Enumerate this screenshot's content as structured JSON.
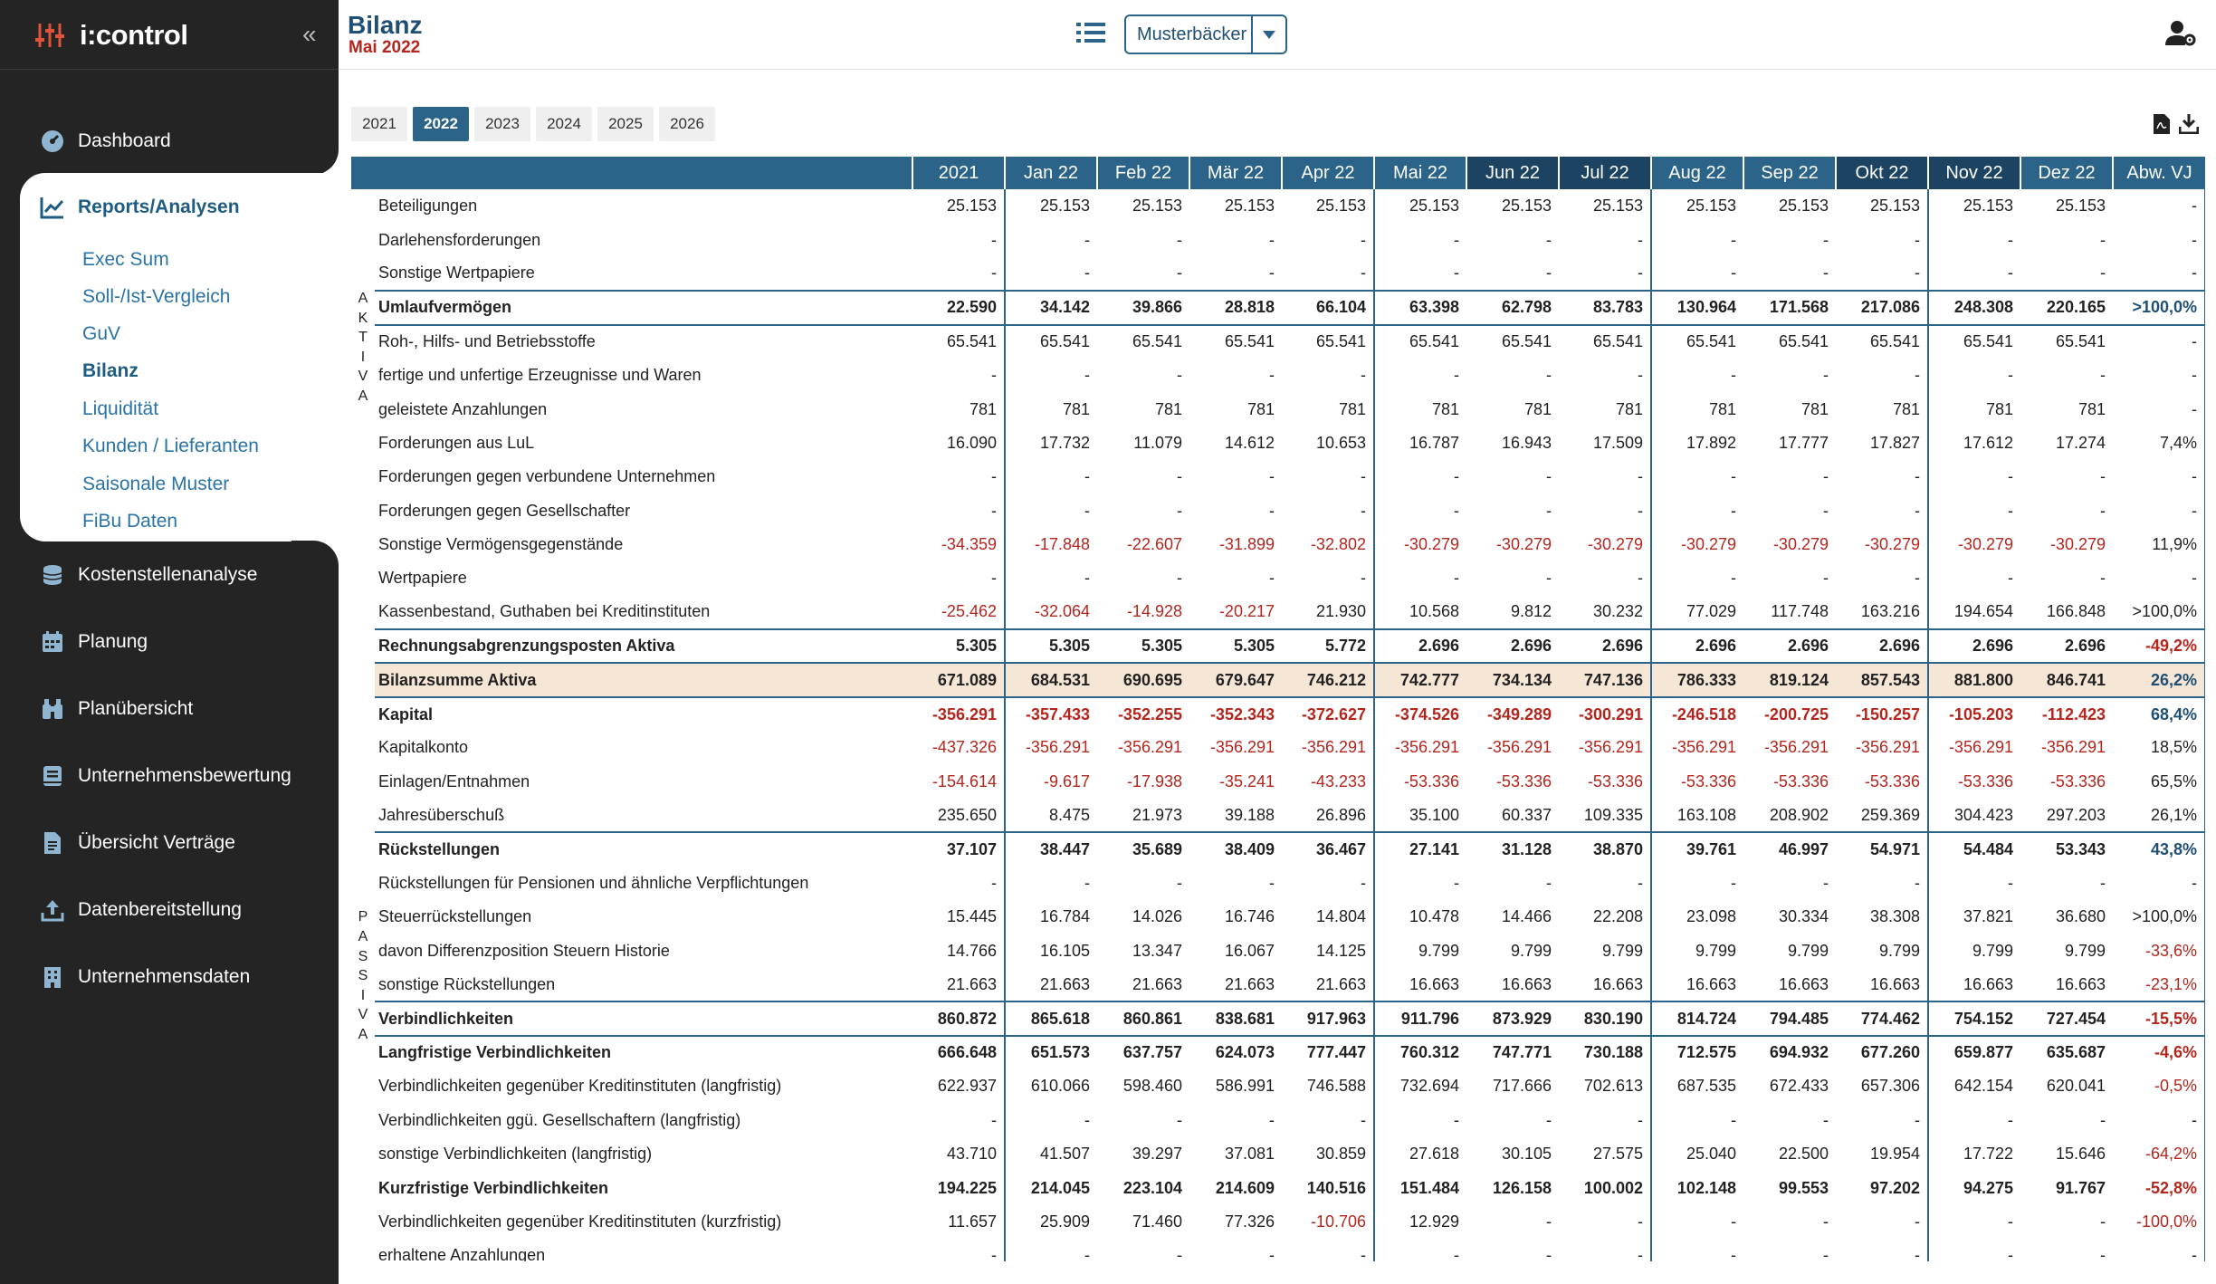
{
  "app": {
    "name": "i:control",
    "collapse_icon": "double-chevron-left-icon"
  },
  "nav": {
    "dashboard": "Dashboard",
    "reports": "Reports/Analysen",
    "sub": [
      "Exec Sum",
      "Soll-/Ist-Vergleich",
      "GuV",
      "Bilanz",
      "Liquidität",
      "Kunden / Lieferanten",
      "Saisonale Muster",
      "FiBu Daten"
    ],
    "kosten": "Kostenstellenanalyse",
    "planung": "Planung",
    "planuebersicht": "Planübersicht",
    "bewertung": "Unternehmensbewertung",
    "vertraege": "Übersicht Verträge",
    "datenbereit": "Datenbereitstellung",
    "unternehmen": "Unternehmensdaten"
  },
  "header": {
    "title": "Bilanz",
    "subtitle": "Mai 2022",
    "company": "Musterbäcker"
  },
  "years": [
    "2021",
    "2022",
    "2023",
    "2024",
    "2025",
    "2026"
  ],
  "selected_year": "2022",
  "side_labels": {
    "aktiva": "AKTIVA",
    "passiva": "PASSIVA"
  },
  "table": {
    "columns": [
      "2021",
      "Jan 22",
      "Feb 22",
      "Mär 22",
      "Apr 22",
      "Mai 22",
      "Jun 22",
      "Jul 22",
      "Aug 22",
      "Sep 22",
      "Okt 22",
      "Nov 22",
      "Dez 22",
      "Abw. VJ"
    ],
    "rows": [
      {
        "label": "Beteiligungen",
        "v": [
          "25.153",
          "25.153",
          "25.153",
          "25.153",
          "25.153",
          "25.153",
          "25.153",
          "25.153",
          "25.153",
          "25.153",
          "25.153",
          "25.153",
          "25.153",
          "-"
        ]
      },
      {
        "label": "Darlehensforderungen",
        "v": [
          "-",
          "-",
          "-",
          "-",
          "-",
          "-",
          "-",
          "-",
          "-",
          "-",
          "-",
          "-",
          "-",
          "-"
        ]
      },
      {
        "label": "Sonstige Wertpapiere",
        "v": [
          "-",
          "-",
          "-",
          "-",
          "-",
          "-",
          "-",
          "-",
          "-",
          "-",
          "-",
          "-",
          "-",
          "-"
        ]
      },
      {
        "label": "Umlaufvermögen",
        "bold": true,
        "v": [
          "22.590",
          "34.142",
          "39.866",
          "28.818",
          "66.104",
          "63.398",
          "62.798",
          "83.783",
          "130.964",
          "171.568",
          "217.086",
          "248.308",
          "220.165",
          ">100,0%"
        ]
      },
      {
        "label": "Roh-, Hilfs- und Betriebsstoffe",
        "v": [
          "65.541",
          "65.541",
          "65.541",
          "65.541",
          "65.541",
          "65.541",
          "65.541",
          "65.541",
          "65.541",
          "65.541",
          "65.541",
          "65.541",
          "65.541",
          "-"
        ]
      },
      {
        "label": "fertige und unfertige Erzeugnisse und Waren",
        "v": [
          "-",
          "-",
          "-",
          "-",
          "-",
          "-",
          "-",
          "-",
          "-",
          "-",
          "-",
          "-",
          "-",
          "-"
        ]
      },
      {
        "label": "geleistete Anzahlungen",
        "v": [
          "781",
          "781",
          "781",
          "781",
          "781",
          "781",
          "781",
          "781",
          "781",
          "781",
          "781",
          "781",
          "781",
          "-"
        ]
      },
      {
        "label": "Forderungen aus LuL",
        "v": [
          "16.090",
          "17.732",
          "11.079",
          "14.612",
          "10.653",
          "16.787",
          "16.943",
          "17.509",
          "17.892",
          "17.777",
          "17.827",
          "17.612",
          "17.274",
          "7,4%"
        ]
      },
      {
        "label": "Forderungen gegen verbundene Unternehmen",
        "v": [
          "-",
          "-",
          "-",
          "-",
          "-",
          "-",
          "-",
          "-",
          "-",
          "-",
          "-",
          "-",
          "-",
          "-"
        ]
      },
      {
        "label": "Forderungen gegen Gesellschafter",
        "v": [
          "-",
          "-",
          "-",
          "-",
          "-",
          "-",
          "-",
          "-",
          "-",
          "-",
          "-",
          "-",
          "-",
          "-"
        ]
      },
      {
        "label": "Sonstige Vermögensgegenstände",
        "v": [
          "-34.359",
          "-17.848",
          "-22.607",
          "-31.899",
          "-32.802",
          "-30.279",
          "-30.279",
          "-30.279",
          "-30.279",
          "-30.279",
          "-30.279",
          "-30.279",
          "-30.279",
          "11,9%"
        ]
      },
      {
        "label": "Wertpapiere",
        "v": [
          "-",
          "-",
          "-",
          "-",
          "-",
          "-",
          "-",
          "-",
          "-",
          "-",
          "-",
          "-",
          "-",
          "-"
        ]
      },
      {
        "label": "Kassenbestand, Guthaben bei Kreditinstituten",
        "v": [
          "-25.462",
          "-32.064",
          "-14.928",
          "-20.217",
          "21.930",
          "10.568",
          "9.812",
          "30.232",
          "77.029",
          "117.748",
          "163.216",
          "194.654",
          "166.848",
          ">100,0%"
        ]
      },
      {
        "label": "Rechnungsabgrenzungsposten Aktiva",
        "bold": true,
        "v": [
          "5.305",
          "5.305",
          "5.305",
          "5.305",
          "5.772",
          "2.696",
          "2.696",
          "2.696",
          "2.696",
          "2.696",
          "2.696",
          "2.696",
          "2.696",
          "-49,2%"
        ]
      },
      {
        "label": "Bilanzsumme Aktiva",
        "bold": true,
        "total": true,
        "v": [
          "671.089",
          "684.531",
          "690.695",
          "679.647",
          "746.212",
          "742.777",
          "734.134",
          "747.136",
          "786.333",
          "819.124",
          "857.543",
          "881.800",
          "846.741",
          "26,2%"
        ]
      },
      {
        "label": "Kapital",
        "bold": true,
        "v": [
          "-356.291",
          "-357.433",
          "-352.255",
          "-352.343",
          "-372.627",
          "-374.526",
          "-349.289",
          "-300.291",
          "-246.518",
          "-200.725",
          "-150.257",
          "-105.203",
          "-112.423",
          "68,4%"
        ]
      },
      {
        "label": "Kapitalkonto",
        "v": [
          "-437.326",
          "-356.291",
          "-356.291",
          "-356.291",
          "-356.291",
          "-356.291",
          "-356.291",
          "-356.291",
          "-356.291",
          "-356.291",
          "-356.291",
          "-356.291",
          "-356.291",
          "18,5%"
        ]
      },
      {
        "label": "Einlagen/Entnahmen",
        "v": [
          "-154.614",
          "-9.617",
          "-17.938",
          "-35.241",
          "-43.233",
          "-53.336",
          "-53.336",
          "-53.336",
          "-53.336",
          "-53.336",
          "-53.336",
          "-53.336",
          "-53.336",
          "65,5%"
        ]
      },
      {
        "label": "Jahresüberschuß",
        "v": [
          "235.650",
          "8.475",
          "21.973",
          "39.188",
          "26.896",
          "35.100",
          "60.337",
          "109.335",
          "163.108",
          "208.902",
          "259.369",
          "304.423",
          "297.203",
          "26,1%"
        ]
      },
      {
        "label": "Rückstellungen",
        "bold": true,
        "v": [
          "37.107",
          "38.447",
          "35.689",
          "38.409",
          "36.467",
          "27.141",
          "31.128",
          "38.870",
          "39.761",
          "46.997",
          "54.971",
          "54.484",
          "53.343",
          "43,8%"
        ]
      },
      {
        "label": "Rückstellungen für Pensionen und ähnliche Verpflichtungen",
        "v": [
          "-",
          "-",
          "-",
          "-",
          "-",
          "-",
          "-",
          "-",
          "-",
          "-",
          "-",
          "-",
          "-",
          "-"
        ]
      },
      {
        "label": "Steuerrückstellungen",
        "v": [
          "15.445",
          "16.784",
          "14.026",
          "16.746",
          "14.804",
          "10.478",
          "14.466",
          "22.208",
          "23.098",
          "30.334",
          "38.308",
          "37.821",
          "36.680",
          ">100,0%"
        ]
      },
      {
        "label": "davon Differenzposition Steuern Historie",
        "v": [
          "14.766",
          "16.105",
          "13.347",
          "16.067",
          "14.125",
          "9.799",
          "9.799",
          "9.799",
          "9.799",
          "9.799",
          "9.799",
          "9.799",
          "9.799",
          "-33,6%"
        ]
      },
      {
        "label": "sonstige Rückstellungen",
        "v": [
          "21.663",
          "21.663",
          "21.663",
          "21.663",
          "21.663",
          "16.663",
          "16.663",
          "16.663",
          "16.663",
          "16.663",
          "16.663",
          "16.663",
          "16.663",
          "-23,1%"
        ]
      },
      {
        "label": "Verbindlichkeiten",
        "bold": true,
        "v": [
          "860.872",
          "865.618",
          "860.861",
          "838.681",
          "917.963",
          "911.796",
          "873.929",
          "830.190",
          "814.724",
          "794.485",
          "774.462",
          "754.152",
          "727.454",
          "-15,5%"
        ]
      },
      {
        "label": "Langfristige Verbindlichkeiten",
        "bold": true,
        "v": [
          "666.648",
          "651.573",
          "637.757",
          "624.073",
          "777.447",
          "760.312",
          "747.771",
          "730.188",
          "712.575",
          "694.932",
          "677.260",
          "659.877",
          "635.687",
          "-4,6%"
        ]
      },
      {
        "label": "Verbindlichkeiten gegenüber Kreditinstituten (langfristig)",
        "v": [
          "622.937",
          "610.066",
          "598.460",
          "586.991",
          "746.588",
          "732.694",
          "717.666",
          "702.613",
          "687.535",
          "672.433",
          "657.306",
          "642.154",
          "620.041",
          "-0,5%"
        ]
      },
      {
        "label": "Verbindlichkeiten ggü. Gesellschaftern (langfristig)",
        "v": [
          "-",
          "-",
          "-",
          "-",
          "-",
          "-",
          "-",
          "-",
          "-",
          "-",
          "-",
          "-",
          "-",
          "-"
        ]
      },
      {
        "label": "sonstige Verbindlichkeiten (langfristig)",
        "v": [
          "43.710",
          "41.507",
          "39.297",
          "37.081",
          "30.859",
          "27.618",
          "30.105",
          "27.575",
          "25.040",
          "22.500",
          "19.954",
          "17.722",
          "15.646",
          "-64,2%"
        ]
      },
      {
        "label": "Kurzfristige Verbindlichkeiten",
        "bold": true,
        "v": [
          "194.225",
          "214.045",
          "223.104",
          "214.609",
          "140.516",
          "151.484",
          "126.158",
          "100.002",
          "102.148",
          "99.553",
          "97.202",
          "94.275",
          "91.767",
          "-52,8%"
        ]
      },
      {
        "label": "Verbindlichkeiten gegenüber Kreditinstituten (kurzfristig)",
        "v": [
          "11.657",
          "25.909",
          "71.460",
          "77.326",
          "-10.706",
          "12.929",
          "-",
          "-",
          "-",
          "-",
          "-",
          "-",
          "-",
          "-100,0%"
        ]
      },
      {
        "label": "erhaltene Anzahlungen",
        "v": [
          "-",
          "-",
          "-",
          "-",
          "-",
          "-",
          "-",
          "-",
          "-",
          "-",
          "-",
          "-",
          "-",
          "-"
        ]
      }
    ]
  }
}
